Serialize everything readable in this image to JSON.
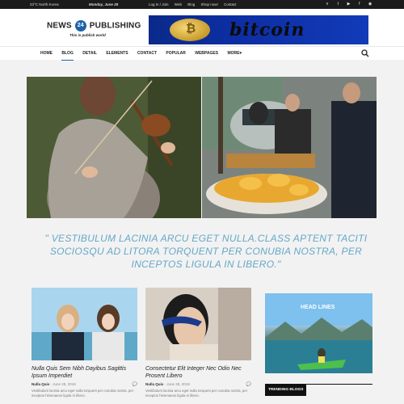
{
  "topbar": {
    "location": "23°C North Korea",
    "date": "Monday, June 28",
    "links": [
      "Log In / Join",
      "Web",
      "Blog",
      "Shop now!",
      "Contact"
    ],
    "social": [
      "vimeo-icon",
      "twitter-icon",
      "youtube-icon",
      "facebook-icon",
      "rss-icon"
    ]
  },
  "header": {
    "logo_left": "NEWS",
    "logo_badge": "24",
    "logo_right": "PUBLISHING",
    "tagline": "This is publish world",
    "ad_text": "bitcoin",
    "ad_coin": "₿"
  },
  "nav": {
    "items": [
      "HOME",
      "BLOG",
      "DETAIL",
      "ELEMENTS",
      "CONTACT",
      "POPULAR",
      "WEBPAGES",
      "MORE▾"
    ],
    "active": "BLOG"
  },
  "quote": "\" VESTIBULUM LACINIA ARCU EGET NULLA.CLASS APTENT TACITI SOCIOSQU AD LITORA TORQUENT PER CONUBIA NOSTRA, PER INCEPTOS LIGULA IN LIBERO.\"",
  "cards": [
    {
      "title": "Nulla Quis Sem Nibh Dayibus Sagittis Ipsum Imperdiet",
      "author": "Nulla Quis",
      "date": "- June 28, 2018",
      "excerpt": "Vestibulum lacinia arcu eget nulla torquent per conubia nostra, per inceptos himenaeos ligula in libero."
    },
    {
      "title": "Consectetur Elit Integer Nec Odio Nec Prosent Libero",
      "author": "Nulla Quis",
      "date": "- June 28, 2018",
      "excerpt": "Vestibulum lacinia arcu eget nulla torquent per conubia nostra, per inceptos himenaeos ligula in libero."
    }
  ],
  "sidebar": {
    "image_label": "HEAD LINES",
    "trending_tab": "TRENDING BLOGS"
  }
}
